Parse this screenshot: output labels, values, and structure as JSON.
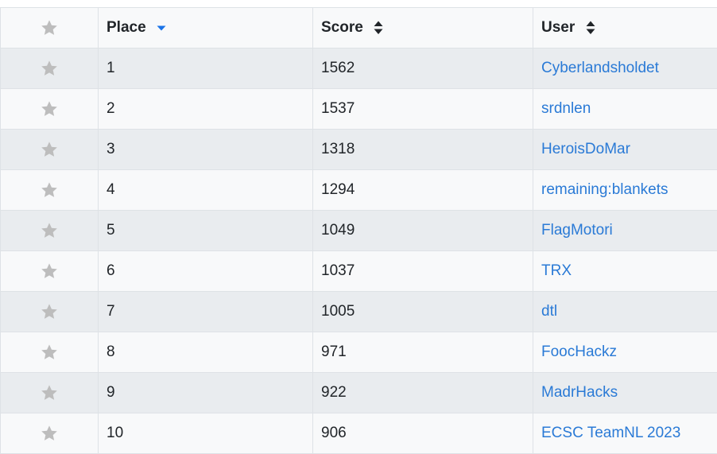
{
  "table": {
    "headers": {
      "place": "Place",
      "score": "Score",
      "user": "User"
    },
    "sort": {
      "column": "place",
      "direction": "descending"
    },
    "colors": {
      "star": "#bdbdbd",
      "link": "#2a7ad6",
      "sort_active": "#1a73e8",
      "row_odd": "#e9ecef",
      "row_even": "#f8f9fa"
    },
    "rows": [
      {
        "place": "1",
        "score": "1562",
        "user": "Cyberlandsholdet"
      },
      {
        "place": "2",
        "score": "1537",
        "user": "srdnlen"
      },
      {
        "place": "3",
        "score": "1318",
        "user": "HeroisDoMar"
      },
      {
        "place": "4",
        "score": "1294",
        "user": "remaining:blankets"
      },
      {
        "place": "5",
        "score": "1049",
        "user": "FlagMotori"
      },
      {
        "place": "6",
        "score": "1037",
        "user": "TRX"
      },
      {
        "place": "7",
        "score": "1005",
        "user": "dtl"
      },
      {
        "place": "8",
        "score": "971",
        "user": "FoocHackz"
      },
      {
        "place": "9",
        "score": "922",
        "user": "MadrHacks"
      },
      {
        "place": "10",
        "score": "906",
        "user": "ECSC TeamNL 2023"
      }
    ]
  }
}
